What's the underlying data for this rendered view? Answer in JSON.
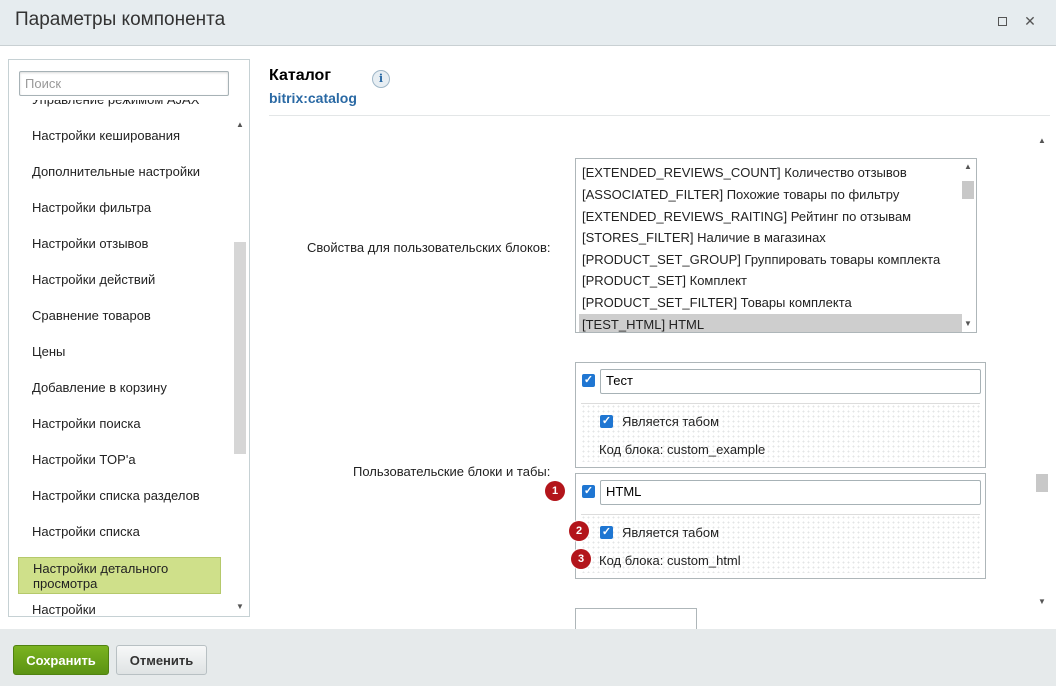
{
  "window": {
    "title": "Параметры компонента",
    "maximize_icon": "maximize-icon",
    "close_glyph": "✕"
  },
  "sidebar": {
    "search_placeholder": "Поиск",
    "items": [
      {
        "label": "Управление режимом AJAX"
      },
      {
        "label": "Настройки кеширования"
      },
      {
        "label": "Дополнительные настройки"
      },
      {
        "label": "Настройки фильтра"
      },
      {
        "label": "Настройки отзывов"
      },
      {
        "label": "Настройки действий"
      },
      {
        "label": "Сравнение товаров"
      },
      {
        "label": "Цены"
      },
      {
        "label": "Добавление в корзину"
      },
      {
        "label": "Настройки поиска"
      },
      {
        "label": "Настройки TOP'а"
      },
      {
        "label": "Настройки списка разделов"
      },
      {
        "label": "Настройки списка"
      },
      {
        "label": "Настройки детального просмотра",
        "active": true
      },
      {
        "label": "Настройки"
      }
    ]
  },
  "header": {
    "title": "Каталог",
    "subtitle": "bitrix:catalog",
    "info_glyph": "i"
  },
  "form": {
    "custom_props_label": "Свойства для пользовательских блоков:",
    "custom_props_options": [
      "[EXTENDED_REVIEWS_COUNT] Количество отзывов",
      "[ASSOCIATED_FILTER] Похожие товары по фильтру",
      "[EXTENDED_REVIEWS_RAITING] Рейтинг по отзывам",
      "[STORES_FILTER] Наличие в магазинах",
      "[PRODUCT_SET_GROUP] Группировать товары комплекта",
      "[PRODUCT_SET] Комплект",
      "[PRODUCT_SET_FILTER] Товары комплекта",
      "[TEST_HTML] HTML"
    ],
    "selected_option": "[TEST_HTML] HTML",
    "blocks_label": "Пользовательские блоки и табы:",
    "blocks": [
      {
        "enabled": true,
        "name": "Тест",
        "is_tab_label": "Является табом",
        "is_tab": true,
        "code_label": "Код блока: custom_example"
      },
      {
        "enabled": true,
        "name": "HTML",
        "is_tab_label": "Является табом",
        "is_tab": true,
        "code_label": "Код блока: custom_html"
      }
    ],
    "badges": [
      "1",
      "2",
      "3"
    ],
    "accent_color": "#1f76d2",
    "badge_color": "#b3151b"
  },
  "footer": {
    "save_label": "Сохранить",
    "cancel_label": "Отменить"
  }
}
